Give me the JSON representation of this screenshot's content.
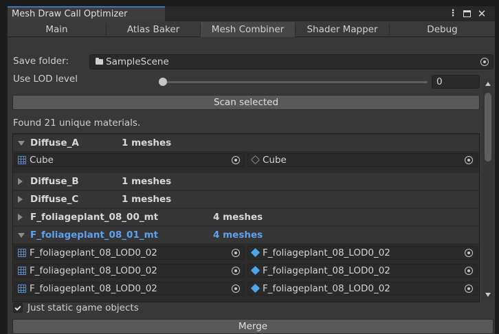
{
  "window": {
    "title": "Mesh Draw Call Optimizer",
    "menu_icon": "kebab-menu-icon",
    "maximize_icon": "maximize-icon",
    "close_icon": "close-icon"
  },
  "tabs": [
    {
      "label": "Main",
      "active": false
    },
    {
      "label": "Atlas Baker",
      "active": false
    },
    {
      "label": "Mesh Combiner",
      "active": true
    },
    {
      "label": "Shader Mapper",
      "active": false
    },
    {
      "label": "Debug",
      "active": false
    }
  ],
  "save_folder": {
    "label": "Save folder:",
    "value": "SampleScene",
    "icon": "folder-icon"
  },
  "lod": {
    "label": "Use LOD level",
    "value": "0"
  },
  "scan_button": "Scan selected",
  "found_text": "Found 21 unique materials.",
  "list": {
    "groups": [
      {
        "name": "Diffuse_A",
        "count": "1 meshes",
        "expanded": true,
        "selected": false
      },
      {
        "name": "Diffuse_B",
        "count": "1 meshes",
        "expanded": false,
        "selected": false
      },
      {
        "name": "Diffuse_C",
        "count": "1 meshes",
        "expanded": false,
        "selected": false
      },
      {
        "name": "F_foliageplant_08_00_mt",
        "count": "4 meshes",
        "expanded": false,
        "selected": false
      },
      {
        "name": "F_foliageplant_08_01_mt",
        "count": "4 meshes",
        "expanded": true,
        "selected": true
      }
    ],
    "diffuse_a_item": {
      "mesh": "Cube",
      "object": "Cube"
    },
    "foliage_items": [
      {
        "mesh": "F_foliageplant_08_LOD0_02",
        "object": "F_foliageplant_08_LOD0_02"
      },
      {
        "mesh": "F_foliageplant_08_LOD0_02",
        "object": "F_foliageplant_08_LOD0_02"
      },
      {
        "mesh": "F_foliageplant_08_LOD0_02",
        "object": "F_foliageplant_08_LOD0_02"
      }
    ]
  },
  "static_toggle": {
    "label": "Just static game objects",
    "checked": true
  },
  "merge_button": "Merge",
  "colors": {
    "accent_tab": "#3a79bb",
    "selected_group": "#5ea2ee",
    "background": "#383838"
  }
}
